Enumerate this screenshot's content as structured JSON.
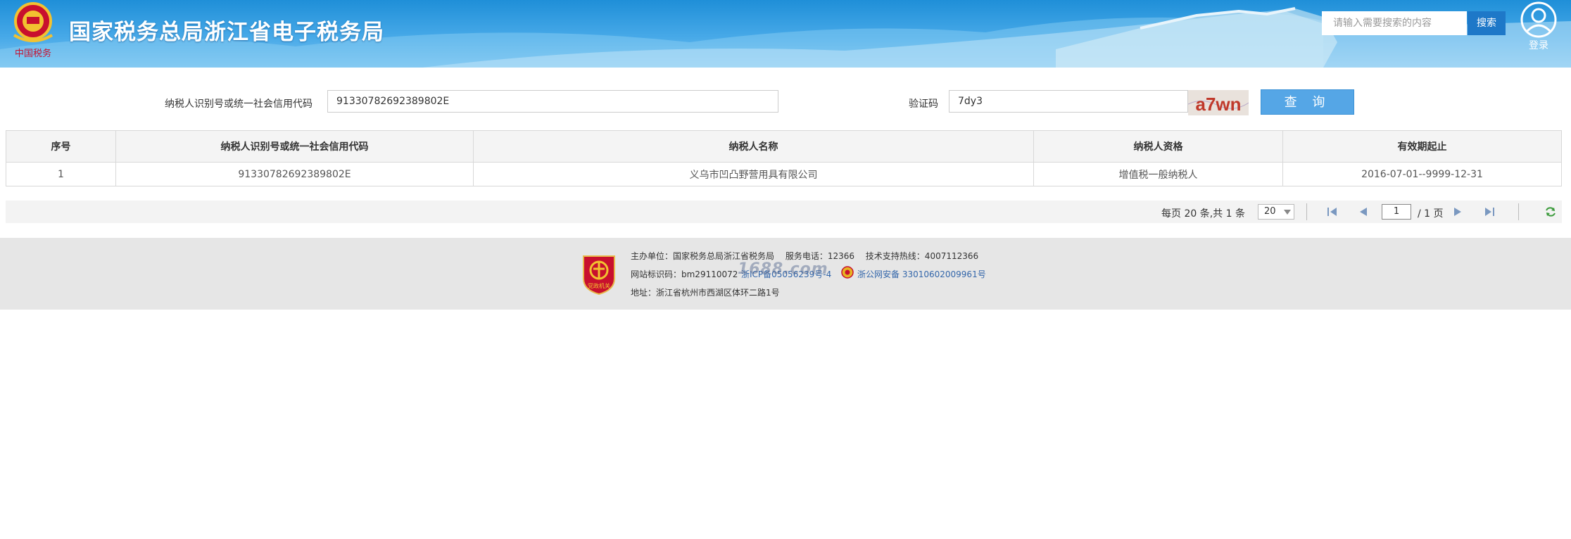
{
  "header": {
    "site_title": "国家税务总局浙江省电子税务局",
    "emblem_caption": "中国税务",
    "search_placeholder": "请输入需要搜索的内容",
    "search_button": "搜索",
    "login": "登录",
    "user_icon": "user-icon"
  },
  "query": {
    "taxpayer_id_label": "纳税人识别号或统一社会信用代码",
    "taxpayer_id_value": "91330782692389802E",
    "captcha_label": "验证码",
    "captcha_value": "7dy3",
    "captcha_image_text": "a7wn",
    "query_button": "查 询"
  },
  "table": {
    "columns": [
      "序号",
      "纳税人识别号或统一社会信用代码",
      "纳税人名称",
      "纳税人资格",
      "有效期起止"
    ],
    "rows": [
      [
        "1",
        "91330782692389802E",
        "义乌市凹凸野营用具有限公司",
        "增值税一般纳税人",
        "2016-07-01--9999-12-31"
      ]
    ]
  },
  "pager": {
    "summary": "每页 20 条,共 1 条",
    "page_size": "20",
    "current_page": "1",
    "total_pages": "/ 1 页"
  },
  "footer": {
    "line1": "主办单位：国家税务总局浙江省税务局　 服务电话：12366　 技术支持热线：4007112366",
    "site_id": "网站标识码：bm29110072",
    "icp": "浙ICP备05056239号-4",
    "watermark": "1688.com",
    "police": "浙公网安备 33010602009961号",
    "address": "地址：浙江省杭州市西湖区体环二路1号",
    "badge_caption": "党政机关"
  },
  "colors": {
    "header_blue": "#1f8fd8",
    "search_button": "#1e78c8",
    "query_button": "#55a6e6",
    "captcha_text": "#c0392b"
  }
}
